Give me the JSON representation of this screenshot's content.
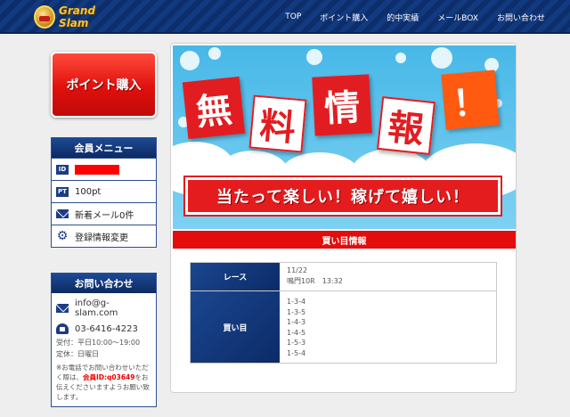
{
  "header": {
    "logo_text": "Grand Slam",
    "nav": [
      "TOP",
      "ポイント購入",
      "的中実績",
      "メールBOX",
      "お問い合わせ"
    ]
  },
  "sidebar": {
    "buy_button": "ポイント購入",
    "member_menu": {
      "title": "会員メニュー",
      "id_badge": "ID",
      "pt_badge": "PT",
      "points": "100pt",
      "mail": "新着メール0件",
      "settings": "登録情報変更"
    },
    "contact": {
      "title": "お問い合わせ",
      "email": "info@g-slam.com",
      "phone": "03-6416-4223",
      "hours": "受付：平日10:00〜19:00",
      "closed": "定休：日曜日",
      "note_prefix": "※お電話でお問い合わせいただく際は、",
      "note_member_id": "会員ID:q03649",
      "note_suffix": "をお伝えくださいますようお願い致します。"
    }
  },
  "banner": {
    "chars": [
      "無",
      "料",
      "情",
      "報",
      "！"
    ],
    "slogan": "当たって楽しい！稼げて嬉しい！"
  },
  "main": {
    "section_title": "買い目情報",
    "race_label": "レース",
    "race_date": "11/22",
    "race_detail": "鳴門10R　13:32",
    "bets_label": "買い目",
    "bets": [
      "1-3-4",
      "1-3-5",
      "1-4-3",
      "1-4-5",
      "1-5-3",
      "1-5-4"
    ]
  },
  "colors": {
    "header_navy": "#0d2e6b",
    "accent_red": "#e40d0d",
    "sky_blue": "#48b8e8"
  }
}
